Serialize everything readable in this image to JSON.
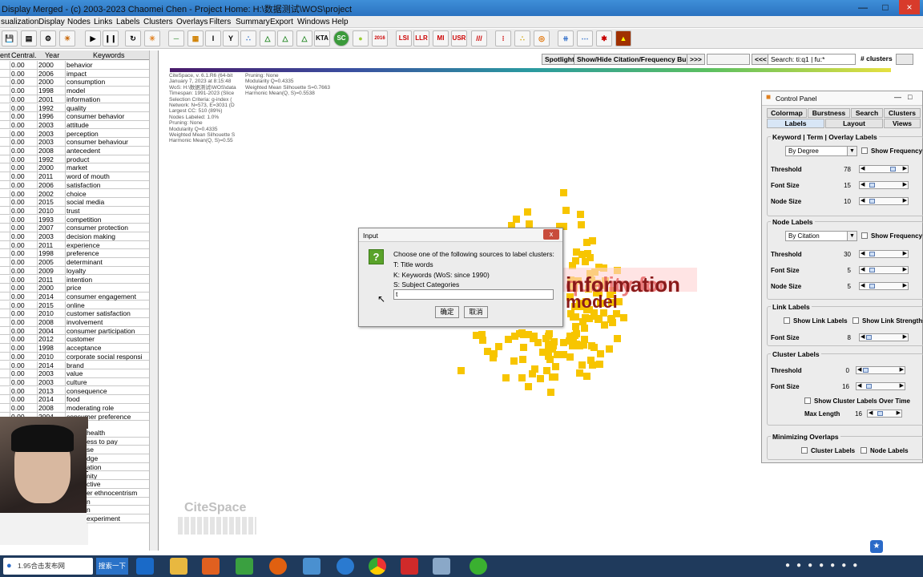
{
  "window": {
    "title": "Display Merged - (c) 2003-2023 Chaomei Chen - Project Home: H:\\数据测试\\WOS\\project"
  },
  "menu": [
    "sualization",
    "Display",
    "Nodes",
    "Links",
    "Labels",
    "Clusters",
    "Overlays",
    "Filters",
    "Summary",
    "Export",
    "Windows",
    "Help"
  ],
  "toolbar": {
    "buttons": [
      "save-icon",
      "film-icon",
      "gear-icon",
      "sun-icon",
      "play-icon",
      "pause-icon",
      "refresh-icon",
      "star-icon",
      "line-icon",
      "grid-icon",
      "I",
      "Y",
      "scatter-icon",
      "tri-a",
      "tri-b",
      "tri-c",
      "KTA",
      "SC",
      "circle-icon",
      "2016",
      "LSI",
      "LLR",
      "MI",
      "USR",
      "///",
      "dots-icon",
      "cluster-icon",
      "target-icon",
      "tree-icon",
      "dash-icon",
      "fire-icon",
      "flame-icon"
    ]
  },
  "table": {
    "headers": [
      "ent",
      "Central.",
      "Year",
      "Keywords"
    ],
    "rows": [
      [
        "0.00",
        "2000",
        "behavior"
      ],
      [
        "0.00",
        "2006",
        "impact"
      ],
      [
        "0.00",
        "2000",
        "consumption"
      ],
      [
        "0.00",
        "1998",
        "model"
      ],
      [
        "0.00",
        "2001",
        "information"
      ],
      [
        "0.00",
        "1992",
        "quality"
      ],
      [
        "0.00",
        "1996",
        "consumer behavior"
      ],
      [
        "0.00",
        "2003",
        "attitude"
      ],
      [
        "0.00",
        "2003",
        "perception"
      ],
      [
        "0.00",
        "2003",
        "consumer behaviour"
      ],
      [
        "0.00",
        "2008",
        "antecedent"
      ],
      [
        "0.00",
        "1992",
        "product"
      ],
      [
        "0.00",
        "2000",
        "market"
      ],
      [
        "0.00",
        "2011",
        "word of mouth"
      ],
      [
        "0.00",
        "2006",
        "satisfaction"
      ],
      [
        "0.00",
        "2002",
        "choice"
      ],
      [
        "0.00",
        "2015",
        "social media"
      ],
      [
        "0.00",
        "2010",
        "trust"
      ],
      [
        "0.00",
        "1993",
        "competition"
      ],
      [
        "0.00",
        "2007",
        "consumer protection"
      ],
      [
        "0.00",
        "2003",
        "decision making"
      ],
      [
        "0.00",
        "2011",
        "experience"
      ],
      [
        "0.00",
        "1998",
        "preference"
      ],
      [
        "0.00",
        "2005",
        "determinant"
      ],
      [
        "0.00",
        "2009",
        "loyalty"
      ],
      [
        "0.00",
        "2011",
        "intention"
      ],
      [
        "0.00",
        "2000",
        "price"
      ],
      [
        "0.00",
        "2014",
        "consumer engagement"
      ],
      [
        "0.00",
        "2015",
        "online"
      ],
      [
        "0.00",
        "2010",
        "customer satisfaction"
      ],
      [
        "0.00",
        "2008",
        "involvement"
      ],
      [
        "0.00",
        "2004",
        "consumer participation"
      ],
      [
        "0.00",
        "2012",
        "customer"
      ],
      [
        "0.00",
        "1998",
        "acceptance"
      ],
      [
        "0.00",
        "2010",
        "corporate social responsi"
      ],
      [
        "0.00",
        "2014",
        "brand"
      ],
      [
        "0.00",
        "2003",
        "value"
      ],
      [
        "0.00",
        "2003",
        "culture"
      ],
      [
        "0.00",
        "2013",
        "consequence"
      ],
      [
        "0.00",
        "2014",
        "food"
      ],
      [
        "0.00",
        "2008",
        "moderating role"
      ],
      [
        "0.00",
        "2004",
        "consumer preference"
      ]
    ],
    "partial_rows": [
      "health",
      "ess to pay",
      "se",
      "dge",
      "ation",
      "nity",
      "ctive",
      "er ethnocentrism",
      "n",
      "n",
      "experiment"
    ]
  },
  "canvas": {
    "buttons": {
      "spotlight": "Spotlight",
      "show_hide": "Show/Hide Citation/Frequency Burst",
      "next": ">>>",
      "prev": "<<<",
      "search": "Search: ti:q1 | fu:*",
      "clusters": "# clusters"
    },
    "info_left": "CiteSpace, v. 6.1.R6 (64-bit\nJanuary 7, 2023 at 8:15:48\nWoS: H:\\数据测试\\WOS\\data\nTimespan: 1991-2023 (Slice\nSelection Criteria: g-index (\nNetwork: N=573, E=3031 (D\nLargest CC: 510 (89%)\nNodes Labeled: 1.0%\nPruning: None\nModularity Q=0.4335\nWeighted Mean Silhouette S\nHarmonic Mean(Q, S)=0.55",
    "info_right": "Pruning: None\nModularity Q=0.4335\nWeighted Mean Silhouette S=0.7663\nHarmonic Mean(Q, S)=0.5538",
    "node_label_1": "information",
    "node_label_2": "quality for",
    "node_label_3": "model",
    "logo": "CiteSpace"
  },
  "dialog": {
    "title": "Input",
    "close": "x",
    "lines": [
      "Choose one of the following sources to label clusters:",
      "T: Title words",
      "K: Keywords (WoS: since 1990)",
      "S: Subject Categories"
    ],
    "input_value": "t",
    "ok": "确定",
    "cancel": "取消"
  },
  "control_panel": {
    "title": "Control Panel",
    "tabs_top": [
      "Colormap",
      "Burstness",
      "Search",
      "Clusters"
    ],
    "tabs_bottom": [
      "Labels",
      "Layout",
      "Views"
    ],
    "kw_section": "Keyword | Term | Overlay Labels",
    "kw_sort": "By Degree",
    "show_frequency": "Show Frequency",
    "threshold": "Threshold",
    "font_size": "Font Size",
    "node_size": "Node Size",
    "kw_threshold": "78",
    "kw_font": "15",
    "kw_node": "10",
    "node_section": "Node Labels",
    "node_sort": "By Citation",
    "nd_threshold": "30",
    "nd_font": "5",
    "nd_node": "5",
    "link_section": "Link Labels",
    "show_link_labels": "Show Link Labels",
    "show_link_strengths": "Show Link Strengths",
    "link_font": "8",
    "cluster_section": "Cluster Labels",
    "cl_threshold": "0",
    "cl_font": "16",
    "show_over_time": "Show Cluster Labels Over Time",
    "max_length": "Max Length",
    "cl_max": "16",
    "overlap_section": "Minimizing Overlaps",
    "ov_cluster": "Cluster Labels",
    "ov_node": "Node Labels"
  },
  "taskbar": {
    "search_text": "1.95合击发布网",
    "search_btn": "搜索一下"
  }
}
